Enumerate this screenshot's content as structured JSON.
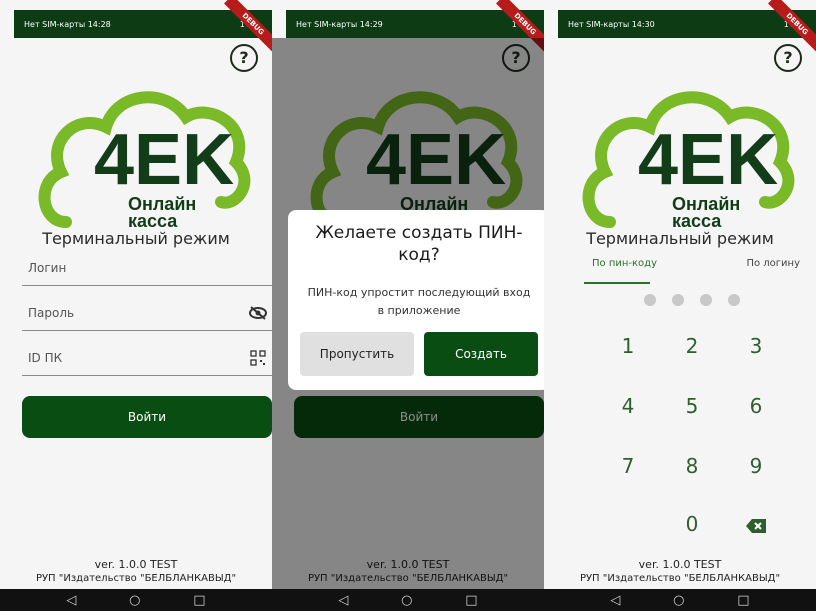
{
  "status": {
    "screen1_left": "Нет SIM-карты 14:28",
    "screen2_left": "Нет SIM-карты 14:29",
    "screen3_left": "Нет SIM-карты 14:30",
    "right": "100",
    "debug": "DEBUG"
  },
  "logo": {
    "mark": "4EK",
    "line1": "Онлайн",
    "line2": "касса",
    "colors": {
      "dark": "#123d18",
      "light": "#7ab928"
    }
  },
  "login": {
    "mode_title": "Терминальный режим",
    "login_label": "Логин",
    "password_label": "Пароль",
    "idpk_label": "ID ПК",
    "enter_button": "Войти"
  },
  "dialog": {
    "title": "Желаете создать ПИН-код?",
    "message": "ПИН-код упростит последующий вход в приложение",
    "skip": "Пропустить",
    "create": "Создать"
  },
  "pin": {
    "tab_pin": "По пин-коду",
    "tab_login": "По логину",
    "keys": [
      "1",
      "2",
      "3",
      "4",
      "5",
      "6",
      "7",
      "8",
      "9",
      "0"
    ]
  },
  "footer": {
    "version": "ver. 1.0.0 TEST",
    "org": "РУП \"Издательство \"БЕЛБЛАНКАВЫД\""
  },
  "help": "?",
  "nav": {
    "back": "◁",
    "home": "○",
    "recent": "□"
  },
  "accent": "#0a4d12"
}
